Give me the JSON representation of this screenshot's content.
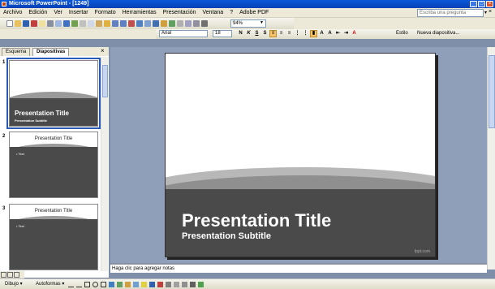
{
  "window": {
    "title": "Microsoft PowerPoint - [1249]",
    "controls": [
      "_",
      "□",
      "×"
    ]
  },
  "menu": {
    "items": [
      "Archivo",
      "Edición",
      "Ver",
      "Insertar",
      "Formato",
      "Herramientas",
      "Presentación",
      "Ventana",
      "?",
      "Adobe PDF"
    ],
    "help_placeholder": "Escriba una pregunta",
    "close_doc": "×"
  },
  "standard_toolbar": {
    "zoom": "94%"
  },
  "formatting_toolbar": {
    "font": "Arial",
    "size": "18",
    "bold": "N",
    "italic": "K",
    "underline": "S",
    "shadow": "S",
    "design": "Estilo",
    "new_slide": "Nueva diapositiva..."
  },
  "left_pane": {
    "tabs": [
      "Esquema",
      "Diapositivas"
    ],
    "close": "×",
    "thumbs": [
      {
        "num": "1",
        "title": "Presentation Title",
        "subtitle": "Presentation Subtitle"
      },
      {
        "num": "2",
        "title": "Presentation Title",
        "bullet": "• Text"
      },
      {
        "num": "3",
        "title": "Presentation Title",
        "bullet": "• Text"
      }
    ]
  },
  "slide": {
    "title": "Presentation Title",
    "subtitle": "Presentation Subtitle",
    "watermark": "fppt.com"
  },
  "notes": {
    "placeholder": "Haga clic para agregar notas"
  },
  "draw_toolbar": {
    "draw": "Dibujo ▾",
    "autoshapes": "Autoformas ▾"
  }
}
